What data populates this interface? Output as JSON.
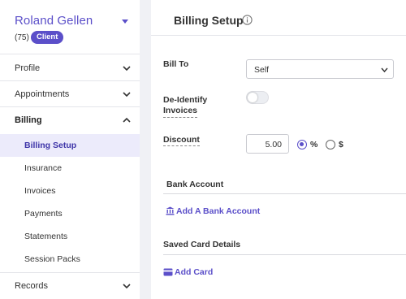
{
  "client": {
    "name": "Roland Gellen",
    "count": "(75)",
    "badge": "Client"
  },
  "sidebar": {
    "items": [
      {
        "label": "Profile"
      },
      {
        "label": "Appointments"
      },
      {
        "label": "Billing"
      },
      {
        "label": "Records"
      }
    ],
    "billing_sub": [
      {
        "label": "Billing Setup"
      },
      {
        "label": "Insurance"
      },
      {
        "label": "Invoices"
      },
      {
        "label": "Payments"
      },
      {
        "label": "Statements"
      },
      {
        "label": "Session Packs"
      }
    ]
  },
  "main": {
    "title": "Billing Setup",
    "bill_to": {
      "label": "Bill To",
      "value": "Self"
    },
    "deidentify": {
      "label_line1": "De-Identify",
      "label_line2": "Invoices",
      "enabled": false
    },
    "discount": {
      "label": "Discount",
      "value": "5.00",
      "option_percent": "%",
      "option_dollar": "$",
      "selected": "%"
    },
    "bank_account": {
      "title": "Bank Account",
      "link": "Add A Bank Account"
    },
    "saved_cards": {
      "title": "Saved Card Details",
      "link": "Add Card"
    }
  },
  "colors": {
    "accent": "#5b4fc9",
    "active_bg": "#ecebfb"
  },
  "icons": {
    "client_dropdown": "caret-down-icon",
    "info": "info-icon",
    "bank": "bank-icon",
    "card": "credit-card-icon"
  }
}
